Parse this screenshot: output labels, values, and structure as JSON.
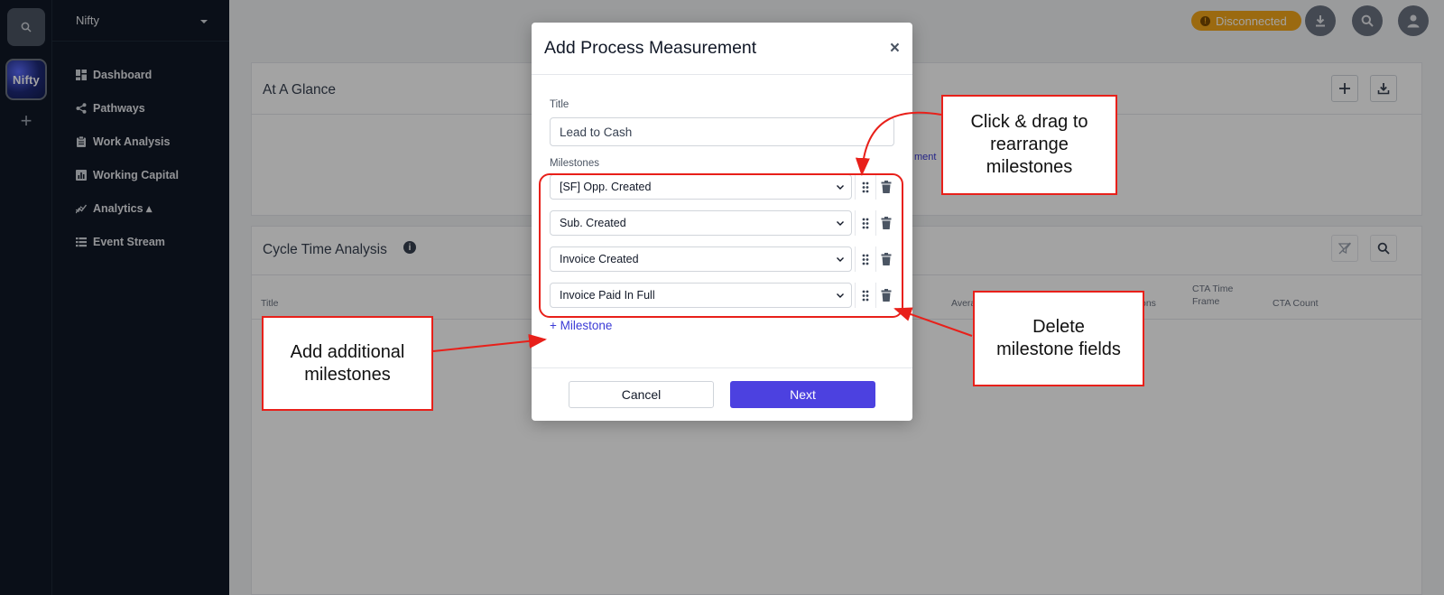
{
  "colors": {
    "sidebar_bg": "#111827",
    "accent": "#4c41e0",
    "link": "#3b3bd6",
    "status_warning": "#f2a619",
    "annotation_red": "#e8201a"
  },
  "rail": {
    "logo_text": "Nifty",
    "search_icon": "search-icon",
    "add_icon": "plus-icon"
  },
  "sidebar": {
    "org_name": "Nifty",
    "items": [
      {
        "label": "Dashboard",
        "icon": "dashboard-icon"
      },
      {
        "label": "Pathways",
        "icon": "share-icon"
      },
      {
        "label": "Work Analysis",
        "icon": "clipboard-icon"
      },
      {
        "label": "Working Capital",
        "icon": "bar-chart-icon"
      },
      {
        "label": "Analytics ▴",
        "icon": "analytics-icon"
      },
      {
        "label": "Event Stream",
        "icon": "list-icon"
      }
    ]
  },
  "topbar": {
    "status_badge": "Disconnected"
  },
  "cards": {
    "glance_title": "At A Glance",
    "glance_link_fragment": "ment",
    "cycle_title": "Cycle Time Analysis",
    "columns": {
      "title": "Title",
      "avg": "Avera",
      "ons": "ons",
      "cta_time_frame": "CTA Time Frame",
      "cta_count": "CTA Count"
    }
  },
  "modal": {
    "title": "Add Process Measurement",
    "close_glyph": "×",
    "title_label": "Title",
    "title_value": "Lead to Cash",
    "milestones_label": "Milestones",
    "milestones": [
      "[SF] Opp. Created",
      "Sub. Created",
      "Invoice Created",
      "Invoice Paid In Full"
    ],
    "add_milestone": "+ Milestone",
    "cancel": "Cancel",
    "next": "Next"
  },
  "annotations": {
    "drag": "Click & drag to rearrange milestones",
    "delete": "Delete milestone fields",
    "add": "Add additional milestones"
  }
}
